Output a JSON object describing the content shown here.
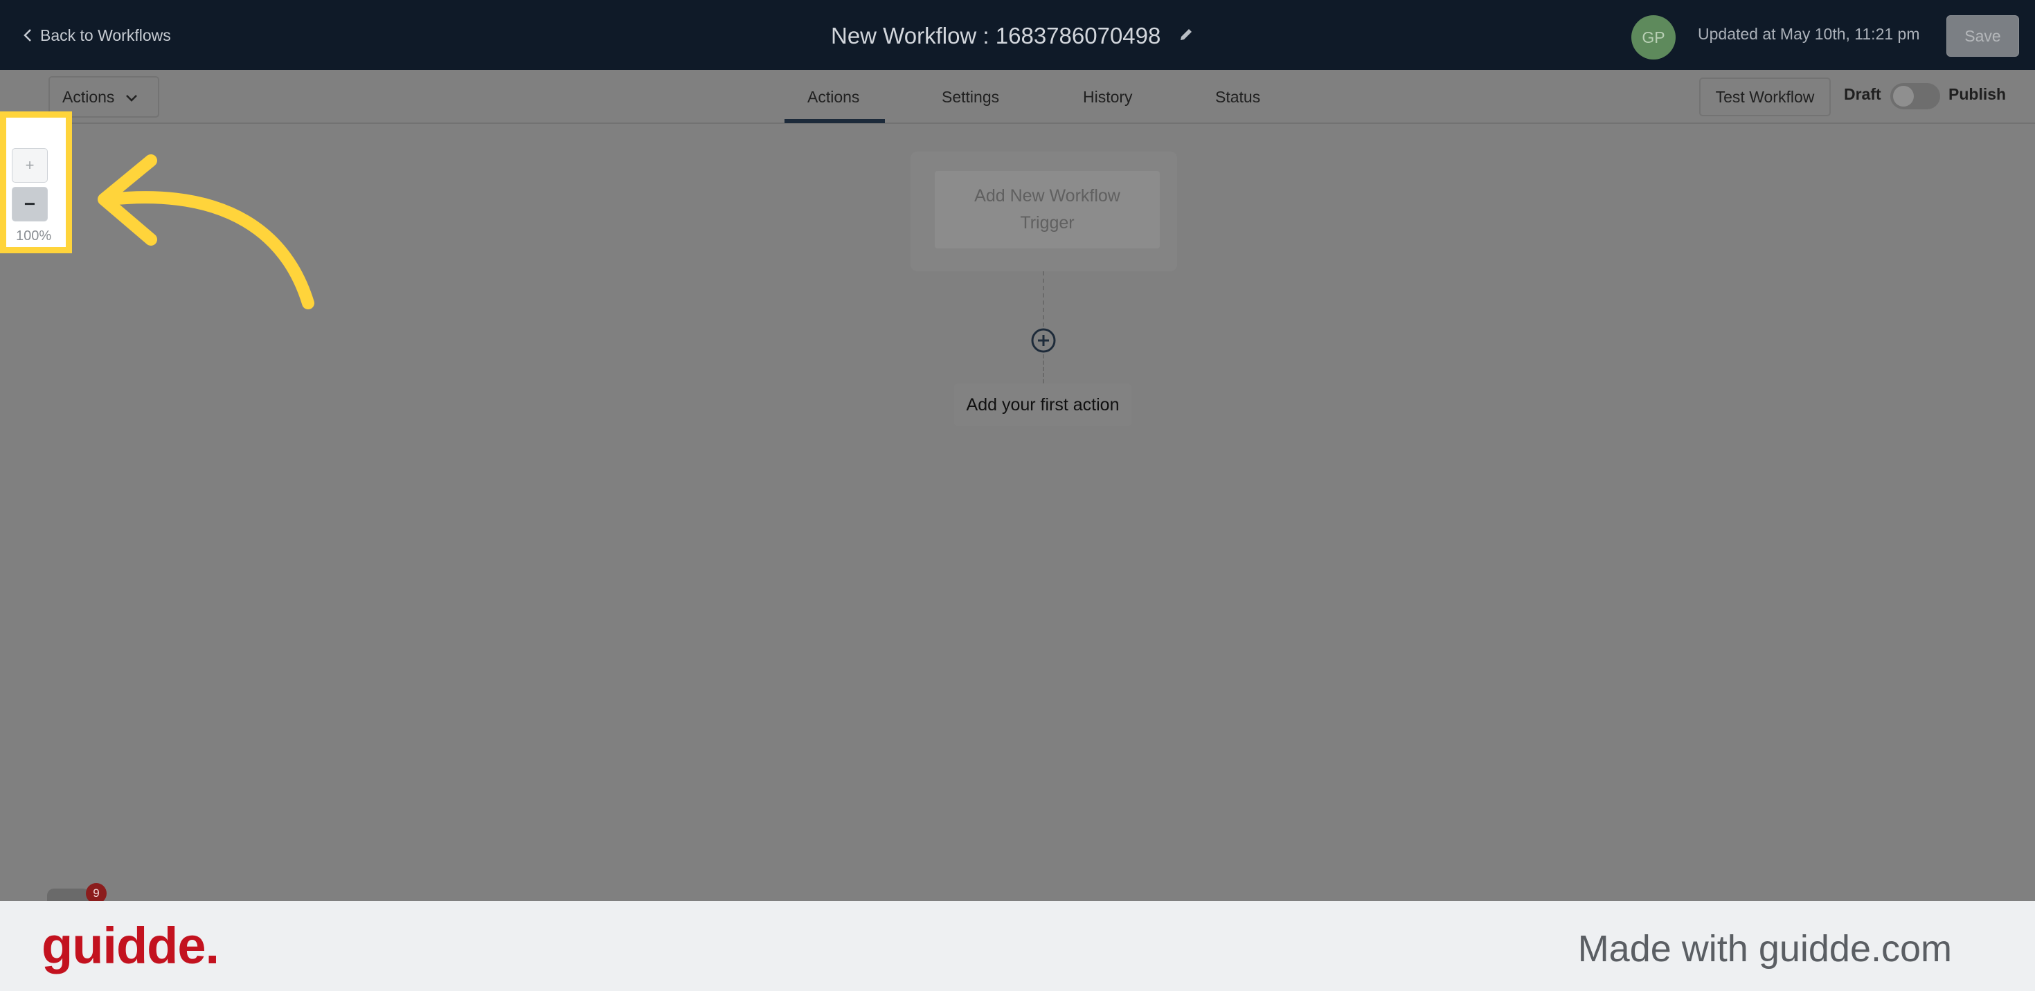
{
  "header": {
    "back_label": "Back to Workflows",
    "workflow_title": "New Workflow : 1683786070498",
    "avatar_initials": "GP",
    "updated_text": "Updated at May 10th, 11:21 pm",
    "save_label": "Save"
  },
  "subbar": {
    "actions_dropdown_label": "Actions",
    "tabs": [
      {
        "label": "Actions",
        "active": true
      },
      {
        "label": "Settings",
        "active": false
      },
      {
        "label": "History",
        "active": false
      },
      {
        "label": "Status",
        "active": false
      }
    ],
    "test_workflow_label": "Test Workflow",
    "draft_label": "Draft",
    "publish_label": "Publish",
    "publish_toggle_on": false
  },
  "zoom": {
    "zoom_in_label": "+",
    "zoom_out_label": "−",
    "level": "100%"
  },
  "canvas": {
    "trigger_label": "Add New Workflow Trigger",
    "first_action_label": "Add your first action"
  },
  "chat": {
    "badge_count": "9"
  },
  "footer": {
    "logo_text": "guidde.",
    "made_with_text": "Made with guidde.com"
  },
  "colors": {
    "header_bg": "#0f1a28",
    "overlay_gray": "#808080",
    "highlight": "#ffd43b",
    "brand_red": "#c3121f"
  }
}
